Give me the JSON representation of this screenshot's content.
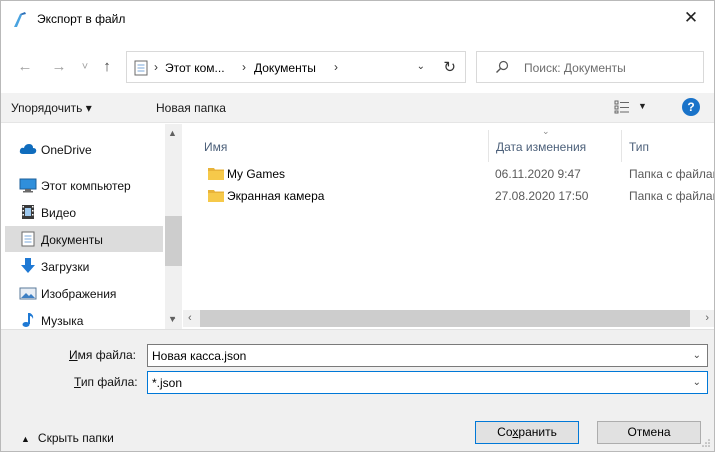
{
  "window": {
    "title": "Экспорт в файл",
    "close_glyph": "✕"
  },
  "nav": {
    "back_glyph": "←",
    "forward_glyph": "→",
    "recent_glyph": "˅",
    "up_glyph": "↑"
  },
  "address": {
    "crumbs": [
      "Этот ком...",
      "Документы"
    ],
    "separator": "›",
    "dropdown_glyph": "⌄",
    "refresh_glyph": "↻"
  },
  "search": {
    "placeholder": "Поиск: Документы"
  },
  "toolbar": {
    "organize_label": "Упорядочить ▾",
    "new_folder_label": "Новая папка"
  },
  "sidebar": {
    "items": [
      {
        "label": "OneDrive",
        "icon": "cloud-icon"
      },
      {
        "label": "Этот компьютер",
        "icon": "computer-icon"
      },
      {
        "label": "Видео",
        "icon": "video-icon"
      },
      {
        "label": "Документы",
        "icon": "documents-icon",
        "selected": true
      },
      {
        "label": "Загрузки",
        "icon": "download-icon"
      },
      {
        "label": "Изображения",
        "icon": "pictures-icon"
      },
      {
        "label": "Музыка",
        "icon": "music-icon"
      }
    ]
  },
  "filelist": {
    "columns": [
      "Имя",
      "Дата изменения",
      "Тип"
    ],
    "rows": [
      {
        "name": "My Games",
        "date": "06.11.2020 9:47",
        "type": "Папка с файлами"
      },
      {
        "name": "Экранная камера",
        "date": "27.08.2020 17:50",
        "type": "Папка с файлами"
      }
    ]
  },
  "form": {
    "filename_label_u": "И",
    "filename_label_rest": "мя файла:",
    "filename_value": "Новая касса.json",
    "filetype_label_u": "Т",
    "filetype_label_rest": "ип файла:",
    "filetype_value": "*.json",
    "hide_folders_label": "Скрыть папки",
    "save_label_pre": "Со",
    "save_label_u": "х",
    "save_label_post": "ранить",
    "cancel_label": "Отмена"
  },
  "colors": {
    "accent": "#0078d7",
    "folder": "#f6c94a",
    "help": "#1a73c9"
  }
}
